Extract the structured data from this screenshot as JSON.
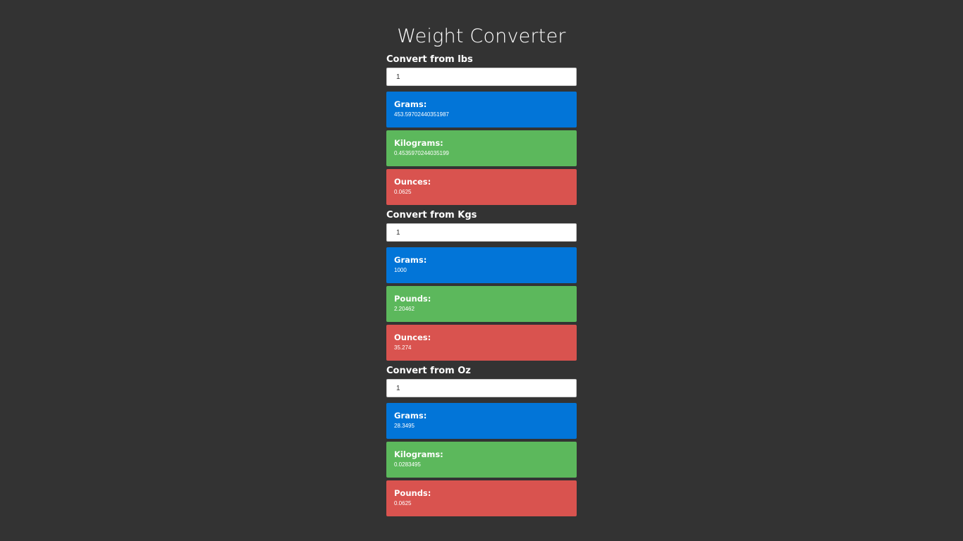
{
  "page": {
    "title": "Weight Converter"
  },
  "colors": {
    "background": "#333333",
    "blue": "#0275d8",
    "green": "#5cb85c",
    "red": "#d9534f"
  },
  "sections": [
    {
      "label": "Convert from lbs",
      "input_value": "1",
      "cards": [
        {
          "title": "Grams:",
          "value": "453.59702440351987",
          "color": "blue"
        },
        {
          "title": "Kilograms:",
          "value": "0.4535970244035199",
          "color": "green"
        },
        {
          "title": "Ounces:",
          "value": "0.0625",
          "color": "red"
        }
      ]
    },
    {
      "label": "Convert from Kgs",
      "input_value": "1",
      "cards": [
        {
          "title": "Grams:",
          "value": "1000",
          "color": "blue"
        },
        {
          "title": "Pounds:",
          "value": "2.20462",
          "color": "green"
        },
        {
          "title": "Ounces:",
          "value": "35.274",
          "color": "red"
        }
      ]
    },
    {
      "label": "Convert from Oz",
      "input_value": "1",
      "cards": [
        {
          "title": "Grams:",
          "value": "28.3495",
          "color": "blue"
        },
        {
          "title": "Kilograms:",
          "value": "0.0283495",
          "color": "green"
        },
        {
          "title": "Pounds:",
          "value": "0.0625",
          "color": "red"
        }
      ]
    }
  ]
}
